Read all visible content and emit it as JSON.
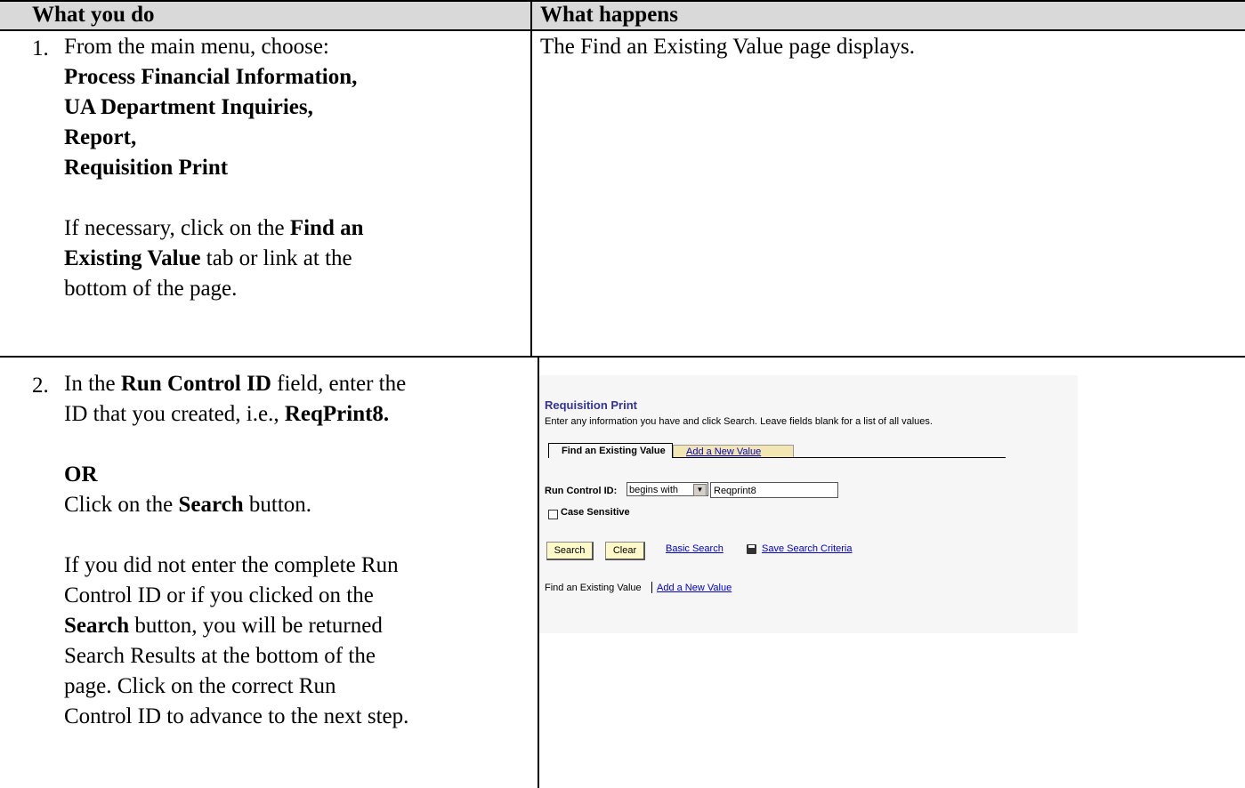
{
  "header": {
    "col1": "What you do",
    "col2": "What happens"
  },
  "row1": {
    "number": "1.",
    "line1": "From the main menu, choose:",
    "path": [
      "Process Financial Information,",
      "UA Department Inquiries,",
      "Report,",
      "Requisition Print"
    ],
    "note_pre": "If necessary, click on the ",
    "note_bold1": "Find an",
    "note_bold2": "Existing Value",
    "note_post1": " tab or link at the",
    "note_post2": "bottom of the page.",
    "result": "The Find an Existing Value page displays."
  },
  "row2": {
    "number": "2.",
    "l1_pre": "In the ",
    "l1_bold": "Run Control ID",
    "l1_post": " field, enter the",
    "l2_pre": "ID that you created, i.e., ",
    "l2_bold": "ReqPrint8.",
    "or": "OR",
    "l3_pre": "Click on the ",
    "l3_bold": "Search",
    "l3_post": " button.",
    "p1": "If you did not enter the complete Run",
    "p2": "Control ID or if you clicked on the",
    "p3_bold": "Search",
    "p3_post": " button, you will be returned",
    "p4": "Search Results at the bottom of the",
    "p5": "page.  Click on the correct Run",
    "p6": "Control ID to advance to the next step."
  },
  "screenshot": {
    "title": "Requisition Print",
    "instructions": "Enter any information you have and click Search. Leave fields blank for a list of all values.",
    "tab_active": "Find an Existing Value",
    "tab_inactive": "Add a New Value",
    "run_control_label": "Run Control ID:",
    "operator": "begins with",
    "run_control_value": "Reqprint8",
    "case_sensitive": "Case Sensitive",
    "search_button": "Search",
    "clear_button": "Clear",
    "basic_search": "Basic Search",
    "save_criteria": "Save Search Criteria",
    "footer_find": "Find an Existing Value",
    "footer_add": "Add a New Value"
  }
}
